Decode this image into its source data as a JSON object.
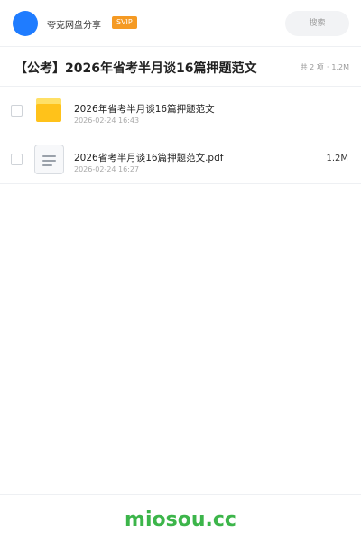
{
  "header": {
    "brand": "夸克网盘分享",
    "badge": "SVIP",
    "search_placeholder": "搜索"
  },
  "folder": {
    "title": "【公考】2026年省考半月谈16篇押题范文",
    "count": "共 2 项",
    "separator": "·",
    "total_size": "1.2M"
  },
  "files": [
    {
      "name": "2026年省考半月谈16篇押题范文",
      "date": "2026-02-24 16:43",
      "size": "",
      "icon": "folder-icon"
    },
    {
      "name": "2026省考半月谈16篇押题范文.pdf",
      "date": "2026-02-24 16:27",
      "size": "1.2M",
      "icon": "file-icon"
    }
  ],
  "footer": {
    "watermark": "miosou.cc"
  },
  "colors": {
    "accent": "#1f7cff",
    "badge": "#f59a23",
    "folder": "#ffc21a",
    "watermark": "#3cb54a"
  }
}
